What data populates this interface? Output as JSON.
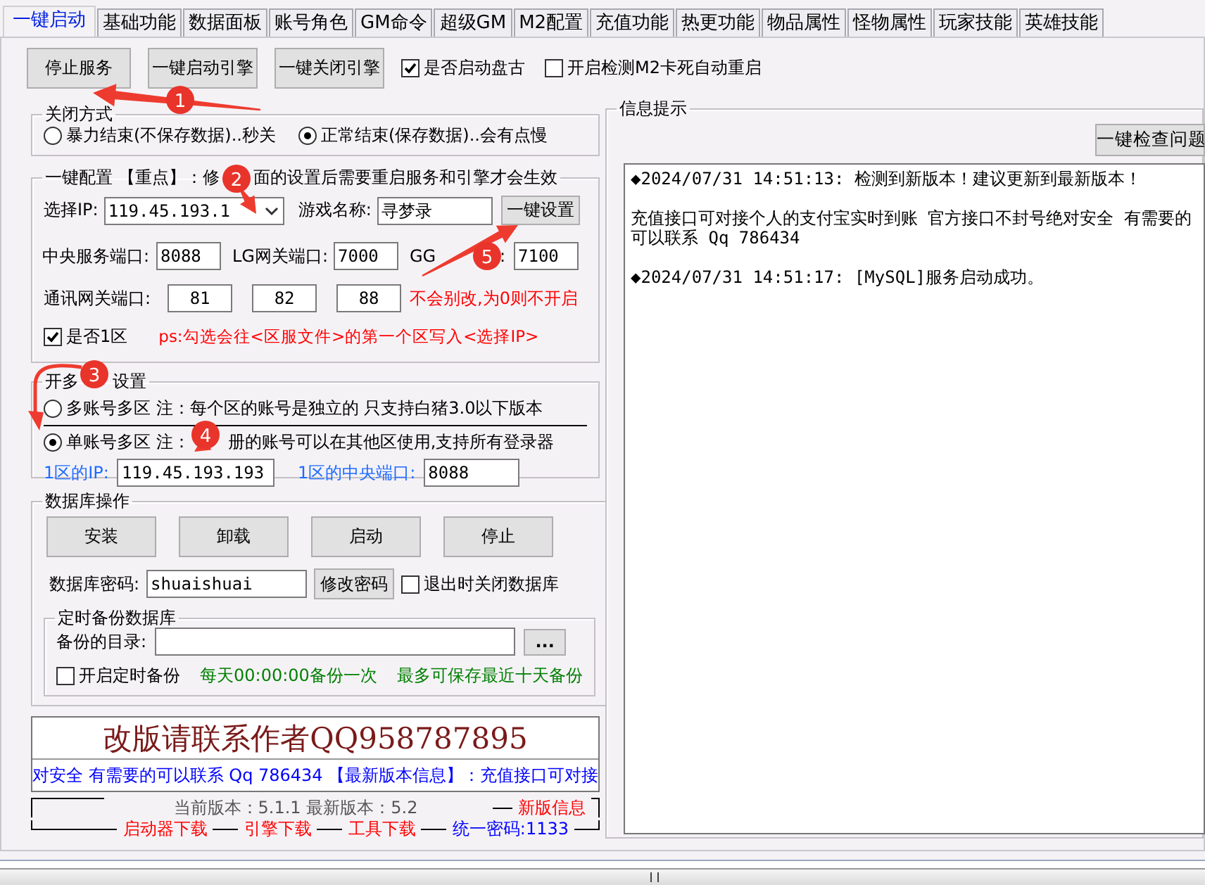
{
  "tabs": [
    {
      "label": "一键启动",
      "selected": true
    },
    {
      "label": "基础功能",
      "selected": false
    },
    {
      "label": "数据面板",
      "selected": false
    },
    {
      "label": "账号角色",
      "selected": false
    },
    {
      "label": "GM命令",
      "selected": false
    },
    {
      "label": "超级GM",
      "selected": false
    },
    {
      "label": "M2配置",
      "selected": false
    },
    {
      "label": "充值功能",
      "selected": false
    },
    {
      "label": "热更功能",
      "selected": false
    },
    {
      "label": "物品属性",
      "selected": false
    },
    {
      "label": "怪物属性",
      "selected": false
    },
    {
      "label": "玩家技能",
      "selected": false
    },
    {
      "label": "英雄技能",
      "selected": false
    }
  ],
  "toolbar": {
    "buttons": [
      "停止服务",
      "一键启动引擎",
      "一键关闭引擎"
    ],
    "checks": [
      {
        "label": "是否启动盘古",
        "checked": true
      },
      {
        "label": "开启检测M2卡死自动重启",
        "checked": false
      }
    ]
  },
  "close_mode": {
    "title": "关闭方式",
    "options": [
      {
        "label": "暴力结束(不保存数据)..秒关",
        "selected": false
      },
      {
        "label": "正常结束(保存数据)..会有点慢",
        "selected": true
      }
    ]
  },
  "config": {
    "title_parts": [
      "一键配置 【重点】：修",
      "面的设置后需要重启服务和引擎才会生效"
    ],
    "ip_label": "选择IP:",
    "ip_value": "119.45.193.1",
    "game_label": "游戏名称:",
    "game_value": "寻梦录",
    "apply_button": "一键设置",
    "ports": [
      {
        "label": "中央服务端口:",
        "value": "8088"
      },
      {
        "label": "LG网关端口:",
        "value": "7000"
      },
      {
        "label": "GG",
        "label_tail": ":",
        "value": "7100"
      }
    ],
    "comm_label": "通讯网关端口:",
    "comm_values": [
      "81",
      "82",
      "88"
    ],
    "comm_note": "不会别改,为0则不开启",
    "zone1": {
      "label": "是否1区",
      "checked": true
    },
    "zone1_note": "ps:勾选会往<区服文件>的第一个区写入<选择IP>"
  },
  "multi_zone": {
    "title_parts": [
      "开多",
      "设置"
    ],
    "options": [
      {
        "label": "多账号多区 注：每个区的账号是独立的 只支持白猪3.0以下版本",
        "selected": false
      },
      {
        "label": "单账号多区 注：",
        "label_tail": "册的账号可以在其他区使用,支持所有登录器",
        "selected": true
      }
    ],
    "ip_label": "1区的IP:",
    "ip_value": "119.45.193.193",
    "port_label": "1区的中央端口:",
    "port_value": "8088"
  },
  "database": {
    "title": "数据库操作",
    "buttons": [
      "安装",
      "卸载",
      "启动",
      "停止"
    ],
    "password_label": "数据库密码:",
    "password_value": "shuaishuai",
    "change_button": "修改密码",
    "close_on_exit": {
      "label": "退出时关闭数据库",
      "checked": false
    },
    "backup": {
      "title": "定时备份数据库",
      "dir_label": "备份的目录:",
      "browse_button": "...",
      "enable": {
        "label": "开启定时备份",
        "checked": false
      },
      "notes": [
        "每天00:00:00备份一次",
        "最多可保存最近十天备份"
      ]
    }
  },
  "banner": {
    "title": "改版请联系作者QQ958787895",
    "marquee": "对安全 有需要的可以联系 Qq 786434 【最新版本信息】：充值接口可对接"
  },
  "version": {
    "current": "当前版本：5.1.1 最新版本：5.2",
    "news_link": "新版信息",
    "links": [
      {
        "label": "启动器下载",
        "color": "#ff0000"
      },
      {
        "label": "引擎下载",
        "color": "#ff0000"
      },
      {
        "label": "工具下载",
        "color": "#ff0000"
      },
      {
        "label": "统一密码:1133",
        "color": "#0000ff"
      }
    ]
  },
  "info": {
    "title": "信息提示",
    "check_button": "一键检查问题",
    "log": [
      "◆2024/07/31 14:51:13:  检测到新版本！建议更新到最新版本！",
      "充值接口可对接个人的支付宝实时到账 官方接口不封号绝对安全 有需要的可以联系 Qq 786434",
      "◆2024/07/31 14:51:17:  [MySQL]服务启动成功。"
    ]
  },
  "annotations": [
    "1",
    "2",
    "3",
    "4",
    "5"
  ]
}
